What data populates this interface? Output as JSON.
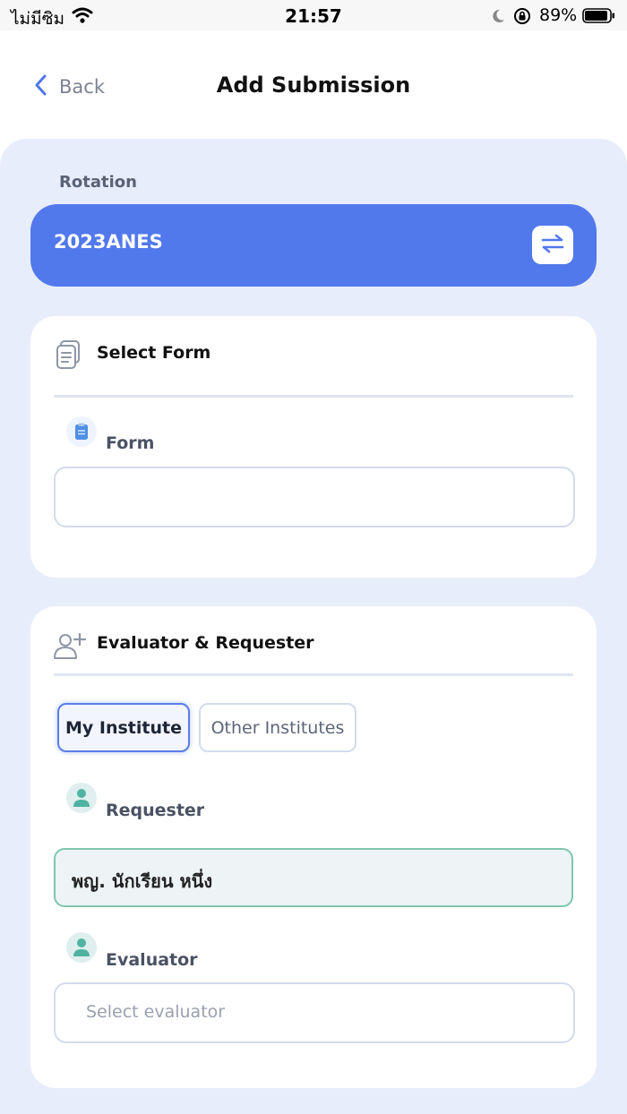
{
  "status_bar": {
    "carrier": "ไม่มีซิม",
    "time": "21:57",
    "battery": "89%"
  },
  "nav": {
    "back_label": "Back",
    "title": "Add Submission"
  },
  "rotation": {
    "label": "Rotation",
    "value": "2023ANES"
  },
  "select_form": {
    "title": "Select Form",
    "form_label": "Form",
    "form_value": ""
  },
  "evaluator_requester": {
    "title": "Evaluator & Requester",
    "tabs": [
      {
        "label": "My Institute",
        "selected": true
      },
      {
        "label": "Other Institutes",
        "selected": false
      }
    ],
    "requester_label": "Requester",
    "requester_value": "พญ. นักเรียน หนึ่ง",
    "evaluator_label": "Evaluator",
    "evaluator_placeholder": "Select evaluator"
  },
  "colors": {
    "accent": "#5279ec",
    "background": "#e7edfb",
    "requester_border": "#7ec7ad",
    "person_icon": "#4fb3a0"
  }
}
